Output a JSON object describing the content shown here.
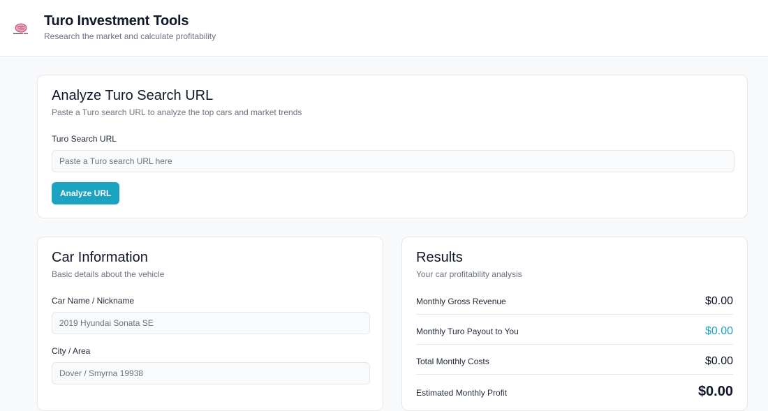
{
  "header": {
    "title": "Turo Investment Tools",
    "subtitle": "Research the market and calculate profitability",
    "logo_icon": "brain-logo-icon"
  },
  "analyze": {
    "title": "Analyze Turo Search URL",
    "description": "Paste a Turo search URL to analyze the top cars and market trends",
    "url_label": "Turo Search URL",
    "url_placeholder": "Paste a Turo search URL here",
    "url_value": "",
    "button_label": "Analyze URL"
  },
  "car_info": {
    "title": "Car Information",
    "description": "Basic details about the vehicle",
    "fields": [
      {
        "label": "Car Name / Nickname",
        "placeholder": "2019 Hyundai Sonata SE",
        "value": ""
      },
      {
        "label": "City / Area",
        "placeholder": "Dover / Smyrna 19938",
        "value": ""
      }
    ]
  },
  "results": {
    "title": "Results",
    "description": "Your car profitability analysis",
    "rows": [
      {
        "label": "Monthly Gross Revenue",
        "value": "$0.00"
      },
      {
        "label": "Monthly Turo Payout to You",
        "value": "$0.00"
      },
      {
        "label": "Total Monthly Costs",
        "value": "$0.00"
      },
      {
        "label": "Estimated Monthly Profit",
        "value": "$0.00"
      }
    ]
  },
  "colors": {
    "accent": "#1da3c2",
    "background": "#f8f9fb",
    "card": "#ffffff",
    "border": "#e6e8ec"
  }
}
